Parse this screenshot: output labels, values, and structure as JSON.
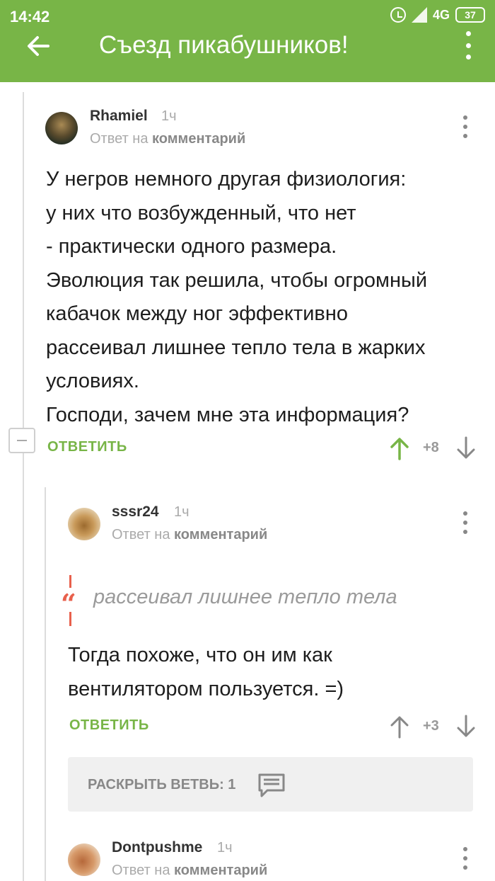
{
  "status_bar": {
    "time": "14:42",
    "network": "4G",
    "battery": "37"
  },
  "header": {
    "title": "Съезд пикабушников!"
  },
  "comments": [
    {
      "author": "Rhamiel",
      "ago": "1ч",
      "reply_prefix": "Ответ на",
      "reply_link": "комментарий",
      "body_lines": [
        "У негров  немного другая физиология:",
        "у них что возбужденный, что  нет",
        "- практически  одного  размера.",
        "Эволюция так решила,  чтобы огромный",
        "кабачок  между ног эффективно",
        "рассеивал лишнее тепло тела в  жарких",
        "условиях.",
        "Господи, зачем мне эта информация?"
      ],
      "reply_label": "ОТВЕТИТЬ",
      "score": "+8",
      "upvoted": true
    },
    {
      "author": "sssr24",
      "ago": "1ч",
      "reply_prefix": "Ответ на",
      "reply_link": "комментарий",
      "quote": "рассеивал лишнее тепло тела",
      "body_lines": [
        "Тогда похоже, что он им как",
        "вентилятором пользуется. =)"
      ],
      "reply_label": "ОТВЕТИТЬ",
      "score": "+3",
      "upvoted": false
    },
    {
      "author": "Dontpushme",
      "ago": "1ч",
      "reply_prefix": "Ответ на",
      "reply_link": "комментарий"
    }
  ],
  "expand_branch": {
    "label": "РАСКРЫТЬ ВЕТВЬ: 1"
  },
  "colors": {
    "accent": "#78b547",
    "quote": "#e8604c",
    "muted": "#aaaaaa"
  }
}
